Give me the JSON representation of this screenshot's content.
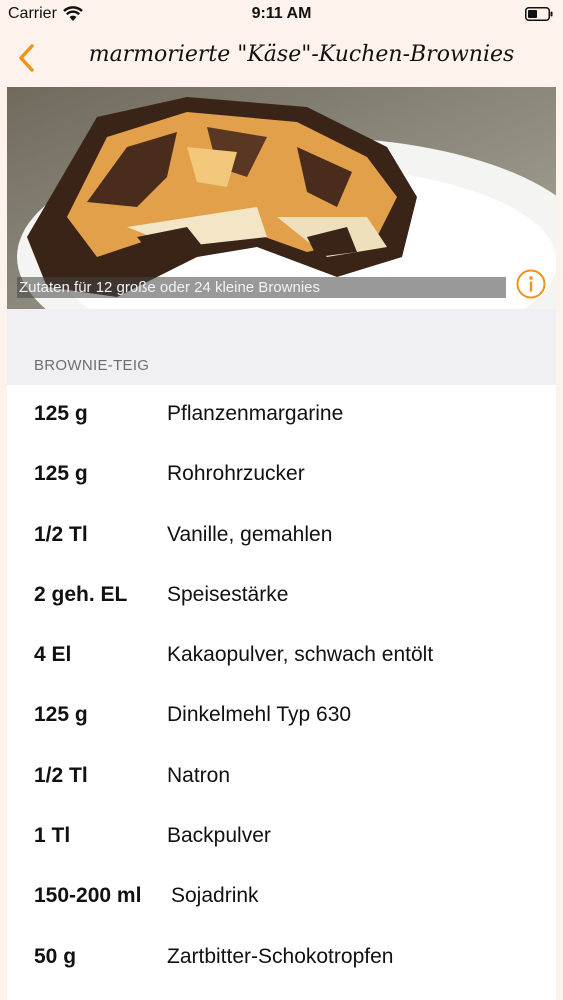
{
  "status_bar": {
    "carrier": "Carrier",
    "time": "9:11 AM"
  },
  "nav": {
    "title": "marmorierte \"Käse\"-Kuchen-Brownies",
    "back_icon": "chevron-left-icon",
    "accent_color": "#f0921c"
  },
  "hero": {
    "caption": "Zutaten für 12 große oder 24 kleine Brownies",
    "info_icon": "info-icon"
  },
  "section": {
    "title": "BROWNIE-TEIG"
  },
  "ingredients": [
    {
      "amount": "125 g",
      "name": "Pflanzenmargarine"
    },
    {
      "amount": "125 g",
      "name": "Rohrohrzucker"
    },
    {
      "amount": "1/2 Tl",
      "name": "Vanille, gemahlen"
    },
    {
      "amount": "2 geh. EL",
      "name": "Speisestärke"
    },
    {
      "amount": "4 El",
      "name": "Kakaopulver, schwach entölt"
    },
    {
      "amount": "125 g",
      "name": "Dinkelmehl Typ 630"
    },
    {
      "amount": "1/2 Tl",
      "name": "Natron"
    },
    {
      "amount": "1 Tl",
      "name": "Backpulver"
    },
    {
      "amount": "150-200 ml",
      "name": "Sojadrink"
    },
    {
      "amount": "50 g",
      "name": "Zartbitter-Schokotropfen"
    }
  ]
}
